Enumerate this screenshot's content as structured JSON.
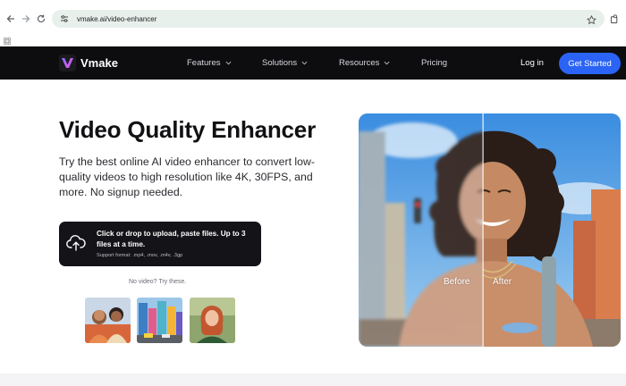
{
  "browser": {
    "url": "vmake.ai/video-enhancer",
    "icons": [
      "back-icon",
      "forward-icon",
      "reload-icon",
      "site-settings-icon",
      "star-icon",
      "extension-icon",
      "apps-grid-icon"
    ]
  },
  "header": {
    "brand": "Vmake",
    "menu": [
      {
        "label": "Features"
      },
      {
        "label": "Solutions"
      },
      {
        "label": "Resources"
      },
      {
        "label": "Pricing"
      }
    ],
    "login": "Log in",
    "cta": "Get Started"
  },
  "hero": {
    "title": "Video Quality Enhancer",
    "subtitle": "Try the best online AI video enhancer to convert low-quality videos to high resolution like 4K, 30FPS, and more. No signup needed.",
    "upload_text": "Click or drop to upload, paste files. Up to 3 files at a time.",
    "upload_formats": "Support format: .mp4, .mov, .m4v, .3gp",
    "try_label": "No video? Try these."
  },
  "compare": {
    "before": "Before",
    "after": "After"
  },
  "colors": {
    "header_bg": "#0d0d10",
    "cta_blue": "#2a63f5",
    "upload_bg": "#141418",
    "urlbar_bg": "#e8f0ec"
  }
}
